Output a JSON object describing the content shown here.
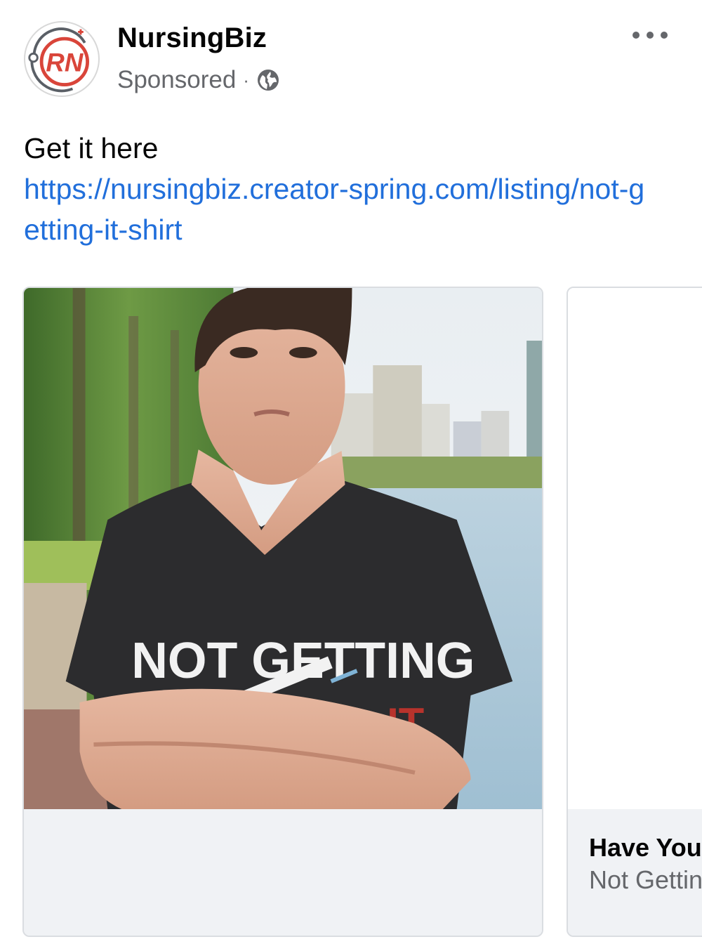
{
  "post": {
    "page_name": "NursingBiz",
    "sponsored_label": "Sponsored",
    "separator": "·",
    "audience_icon": "globe-icon",
    "more_icon": "more-options-icon",
    "avatar_text": "RN",
    "text": "Get it here",
    "link": "https://nursingbiz.creator-spring.com/listing/not-getting-it-shirt"
  },
  "carousel": {
    "cards": [
      {
        "shirt_print_line1": "NOT GETTING",
        "shirt_print_line2": "IT"
      },
      {
        "title": "Have You",
        "subtitle": "Not Gettin"
      }
    ]
  },
  "colors": {
    "link": "#216fdb",
    "secondary_text": "#65676b",
    "card_footer": "#f0f2f5",
    "brand_red": "#d9453a"
  }
}
